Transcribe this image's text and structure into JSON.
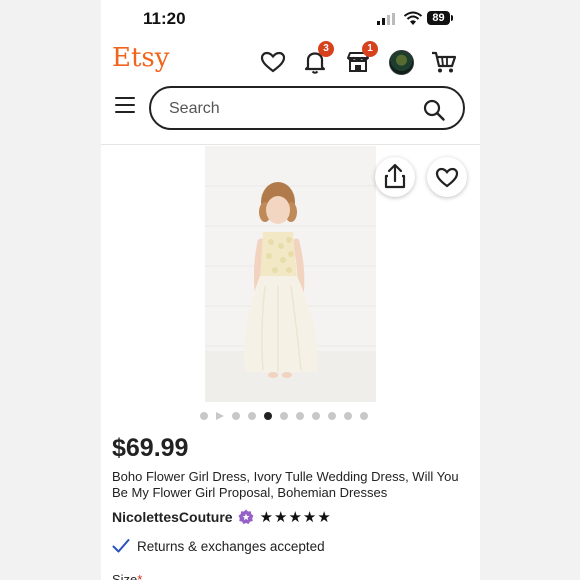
{
  "status_bar": {
    "time": "11:20",
    "battery": "89"
  },
  "header": {
    "logo": "Etsy",
    "notifications_count": "3",
    "shop_updates_count": "1"
  },
  "search": {
    "placeholder": "Search"
  },
  "gallery": {
    "total_images": 11,
    "active_index": 4
  },
  "product": {
    "price": "$69.99",
    "title": "Boho Flower Girl Dress, Ivory Tulle Wedding Dress, Will You Be My Flower Girl Proposal, Bohemian Dresses",
    "shop_name": "NicolettesCouture",
    "rating_stars": "★★★★★",
    "returns": "Returns & exchanges accepted",
    "size_label": "Size",
    "required_mark": "*"
  },
  "colors": {
    "brand": "#f1641e",
    "badge": "#d6421d",
    "check": "#2a52be",
    "star_seller": "#9560c8"
  }
}
